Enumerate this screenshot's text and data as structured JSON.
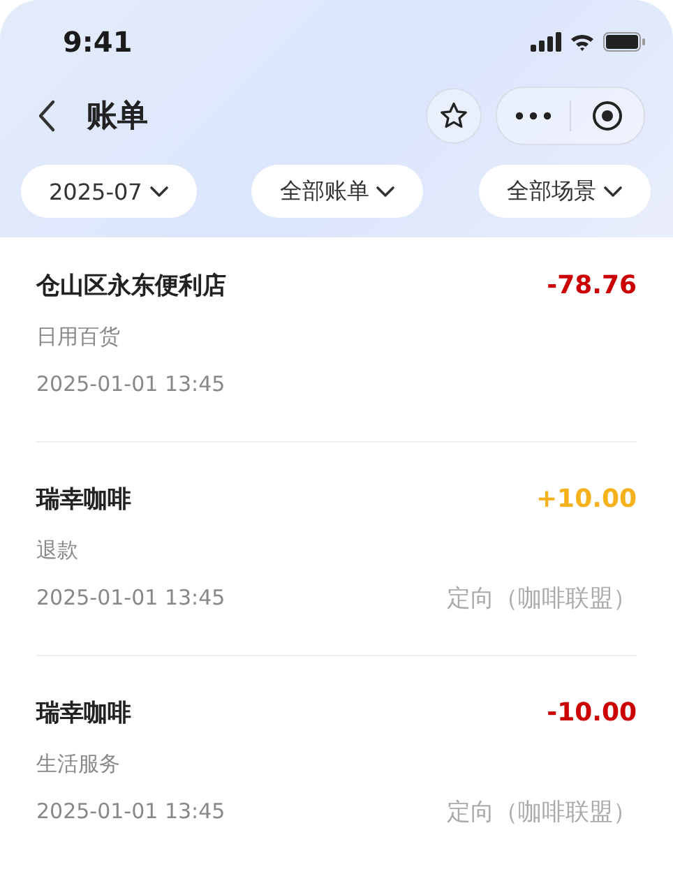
{
  "status_bar": {
    "time": "9:41"
  },
  "nav": {
    "title": "账单"
  },
  "filters": [
    {
      "label": "2025-07"
    },
    {
      "label": "全部账单"
    },
    {
      "label": "全部场景"
    }
  ],
  "transactions": [
    {
      "merchant": "仓山区永东便利店",
      "amount": "-78.76",
      "color": "#cc0000",
      "category": "日用百货",
      "time": "2025-01-01 13:45"
    },
    {
      "merchant": "瑞幸咖啡",
      "amount": "+10.00",
      "color": "#f5b21c",
      "category": "退款",
      "time": "2025-01-01 13:45",
      "tag": "定向（咖啡联盟）"
    },
    {
      "merchant": "瑞幸咖啡",
      "amount": "-10.00",
      "color": "#cc0000",
      "category": "生活服务",
      "time": "2025-01-01 13:45",
      "tag": "定向（咖啡联盟）"
    }
  ]
}
